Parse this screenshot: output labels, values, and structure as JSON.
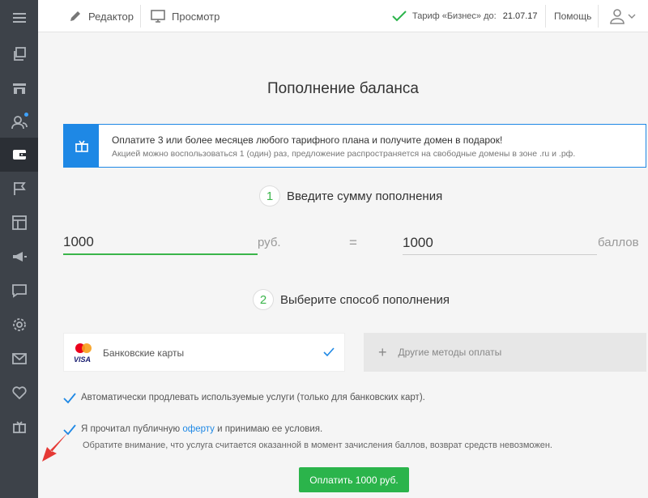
{
  "sidebar": {
    "items": [
      {
        "icon": "menu-icon"
      },
      {
        "icon": "copy-icon"
      },
      {
        "icon": "store-icon"
      },
      {
        "icon": "users-icon"
      },
      {
        "icon": "wallet-icon"
      },
      {
        "icon": "flag-icon"
      },
      {
        "icon": "layout-icon"
      },
      {
        "icon": "megaphone-icon"
      },
      {
        "icon": "chat-icon"
      },
      {
        "icon": "settings-icon"
      },
      {
        "icon": "mail-icon"
      },
      {
        "icon": "heart-icon"
      },
      {
        "icon": "gift-icon"
      }
    ]
  },
  "topbar": {
    "editor_label": "Редактор",
    "preview_label": "Просмотр",
    "tariff_label": "Тариф «Бизнес» до:",
    "tariff_date": "21.07.17",
    "help_label": "Помощь"
  },
  "main": {
    "title": "Пополнение баланса",
    "promo": {
      "line1": "Оплатите 3 или более месяцев любого тарифного плана и получите домен в подарок!",
      "line2": "Акцией можно воспользоваться 1 (один) раз, предложение распространяется на свободные домены в зоне .ru и .рф."
    },
    "step1": {
      "num": "1",
      "label": "Введите сумму пополнения"
    },
    "amount_value": "1000",
    "amount_unit": "руб.",
    "equals": "=",
    "points_value": "1000",
    "points_unit": "баллов",
    "step2": {
      "num": "2",
      "label": "Выберите способ пополнения"
    },
    "pay_card_label": "Банковские карты",
    "pay_other_label": "Другие методы оплаты",
    "auto_renew_label": "Автоматически продлевать используемые услуги (только для банковских карт).",
    "offer_before": "Я прочитал публичную ",
    "offer_link": "оферту",
    "offer_after": " и принимаю ее условия.",
    "note": "Обратите внимание, что услуга считается оказанной в момент зачисления баллов, возврат средств невозможен.",
    "pay_button": "Оплатить 1000 руб."
  },
  "colors": {
    "sidebar_bg": "#3d4249",
    "accent_green": "#2bb44b",
    "accent_blue": "#1e88e5",
    "arrow_red": "#e53935"
  }
}
